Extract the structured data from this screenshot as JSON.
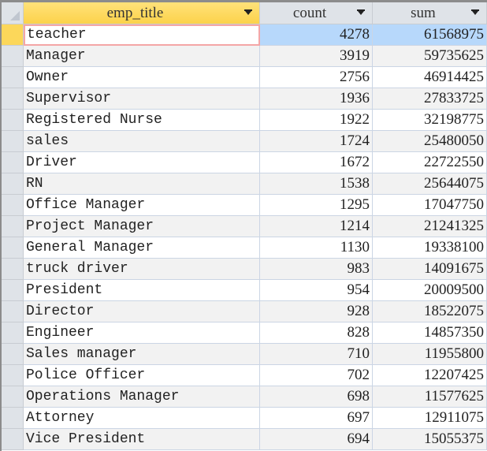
{
  "table": {
    "columns": [
      {
        "label": "emp_title",
        "sorted": true
      },
      {
        "label": "count"
      },
      {
        "label": "sum"
      }
    ],
    "current_row": 0,
    "rows": [
      {
        "emp_title": "teacher",
        "count": "4278",
        "sum": "61568975"
      },
      {
        "emp_title": "Manager",
        "count": "3919",
        "sum": "59735625"
      },
      {
        "emp_title": "Owner",
        "count": "2756",
        "sum": "46914425"
      },
      {
        "emp_title": "Supervisor",
        "count": "1936",
        "sum": "27833725"
      },
      {
        "emp_title": "Registered Nurse",
        "count": "1922",
        "sum": "32198775"
      },
      {
        "emp_title": "sales",
        "count": "1724",
        "sum": "25480050"
      },
      {
        "emp_title": "Driver",
        "count": "1672",
        "sum": "22722550"
      },
      {
        "emp_title": "RN",
        "count": "1538",
        "sum": "25644075"
      },
      {
        "emp_title": "Office Manager",
        "count": "1295",
        "sum": "17047750"
      },
      {
        "emp_title": "Project Manager",
        "count": "1214",
        "sum": "21241325"
      },
      {
        "emp_title": "General Manager",
        "count": "1130",
        "sum": "19338100"
      },
      {
        "emp_title": "truck driver",
        "count": "983",
        "sum": "14091675"
      },
      {
        "emp_title": "President",
        "count": "954",
        "sum": "20009500"
      },
      {
        "emp_title": "Director",
        "count": "928",
        "sum": "18522075"
      },
      {
        "emp_title": "Engineer",
        "count": "828",
        "sum": "14857350"
      },
      {
        "emp_title": "Sales manager",
        "count": "710",
        "sum": "11955800"
      },
      {
        "emp_title": "Police Officer",
        "count": "702",
        "sum": "12207425"
      },
      {
        "emp_title": "Operations Manager",
        "count": "698",
        "sum": "11577625"
      },
      {
        "emp_title": "Attorney",
        "count": "697",
        "sum": "12911075"
      },
      {
        "emp_title": "Vice President",
        "count": "694",
        "sum": "15055375"
      }
    ]
  },
  "colors": {
    "selected_header": "#fcd24a",
    "current_row_highlight": "#b7d8fb",
    "current_cell_border": "#f4a6a6"
  }
}
